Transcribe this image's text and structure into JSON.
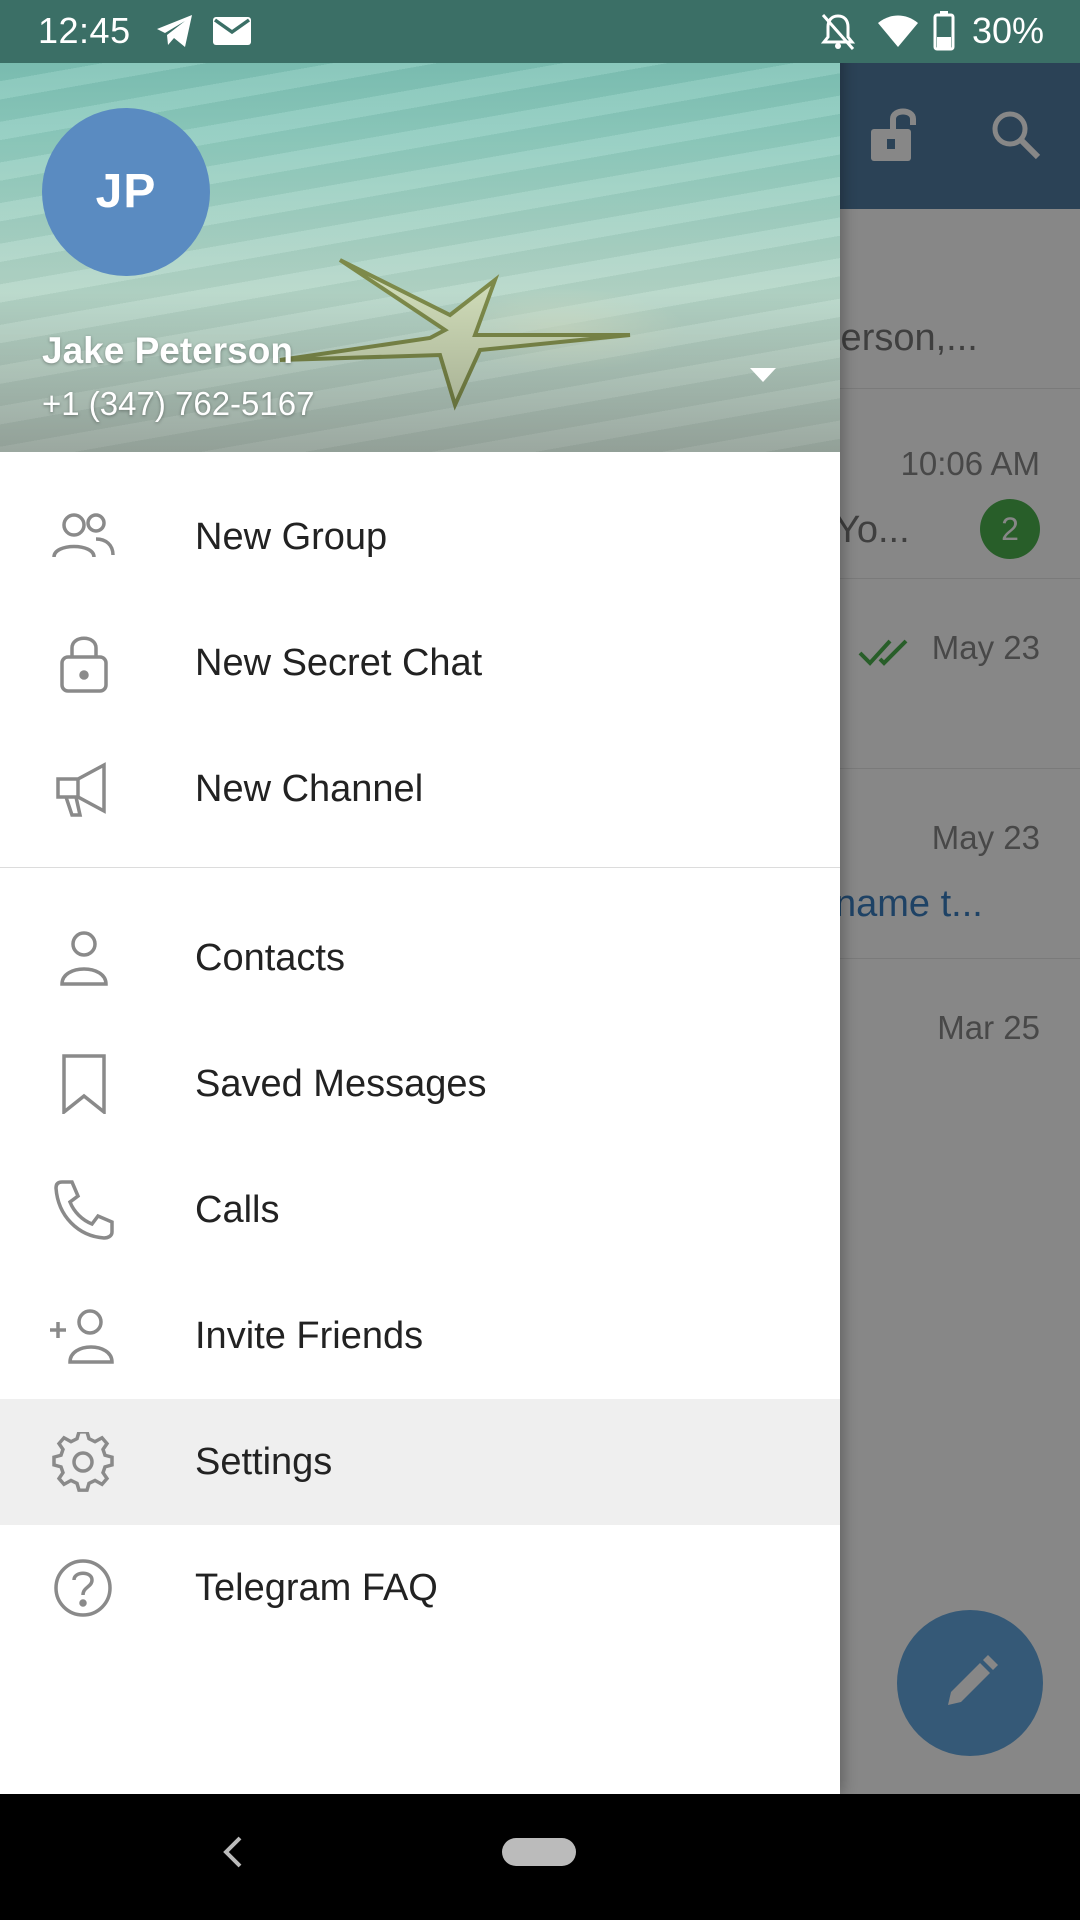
{
  "status_bar": {
    "time": "12:45",
    "battery_text": "30%",
    "icons": [
      "telegram-icon",
      "mail-icon",
      "do-not-disturb-icon",
      "wifi-icon",
      "battery-icon"
    ]
  },
  "background_chats": {
    "header_icons": [
      "lock-icon",
      "search-icon"
    ],
    "rows": [
      {
        "snippet": "terson,...",
        "time": "",
        "badge": ""
      },
      {
        "snippet": "Yo...",
        "time": "10:06 AM",
        "badge": "2"
      },
      {
        "snippet": "",
        "time": "May 23",
        "badge": ""
      },
      {
        "snippet": "name t...",
        "time": "May 23",
        "badge": ""
      },
      {
        "snippet": "",
        "time": "Mar 25",
        "badge": ""
      }
    ],
    "fab_icon": "pencil-icon"
  },
  "drawer": {
    "avatar_initials": "JP",
    "user_name": "Jake Peterson",
    "user_phone": "+1 (347) 762-5167",
    "menu_group_1": [
      {
        "label": "New Group",
        "icon": "group-icon"
      },
      {
        "label": "New Secret Chat",
        "icon": "lock-icon"
      },
      {
        "label": "New Channel",
        "icon": "megaphone-icon"
      }
    ],
    "menu_group_2": [
      {
        "label": "Contacts",
        "icon": "person-icon"
      },
      {
        "label": "Saved Messages",
        "icon": "bookmark-icon"
      },
      {
        "label": "Calls",
        "icon": "phone-icon"
      },
      {
        "label": "Invite Friends",
        "icon": "add-person-icon"
      },
      {
        "label": "Settings",
        "icon": "gear-icon",
        "active": true
      },
      {
        "label": "Telegram FAQ",
        "icon": "help-icon"
      }
    ]
  },
  "colors": {
    "header_blue": "#517da2",
    "avatar": "#5a8bc1",
    "badge_green": "#4cb14f",
    "fab": "#65a9e0",
    "active_row": "#efefef"
  }
}
